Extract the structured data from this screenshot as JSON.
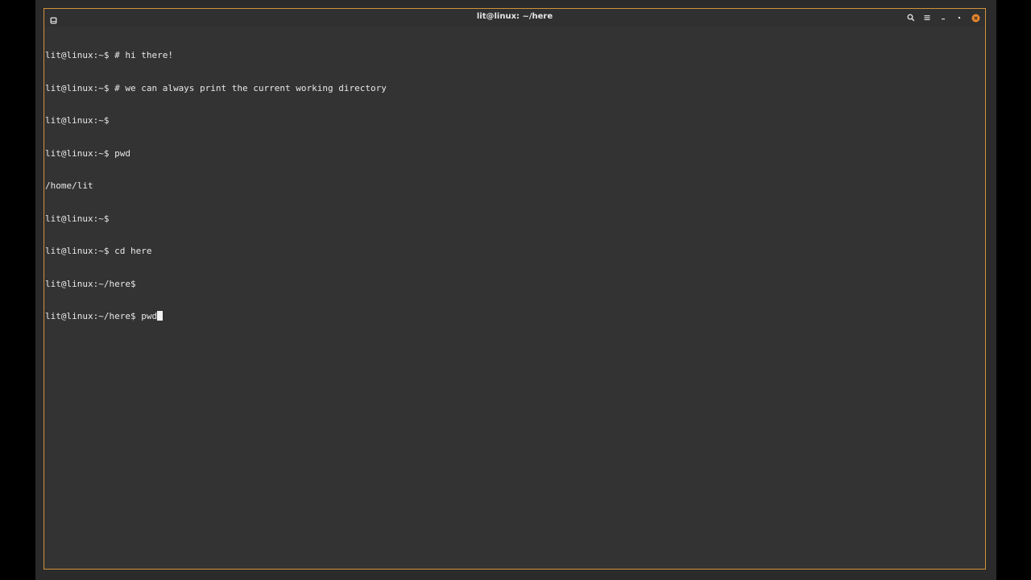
{
  "window": {
    "title": "lit@linux: ~/here",
    "accent_color": "#d4923a"
  },
  "titlebar": {
    "tab_icon": "terminal-tab-icon",
    "buttons": [
      "search-icon",
      "menu-icon",
      "minimize-icon",
      "maximize-icon",
      "close-icon"
    ]
  },
  "terminal": {
    "lines": [
      "lit@linux:~$ # hi there!",
      "lit@linux:~$ # we can always print the current working directory",
      "lit@linux:~$",
      "lit@linux:~$ pwd",
      "/home/lit",
      "lit@linux:~$",
      "lit@linux:~$ cd here",
      "lit@linux:~/here$",
      "lit@linux:~/here$ pwd"
    ]
  }
}
